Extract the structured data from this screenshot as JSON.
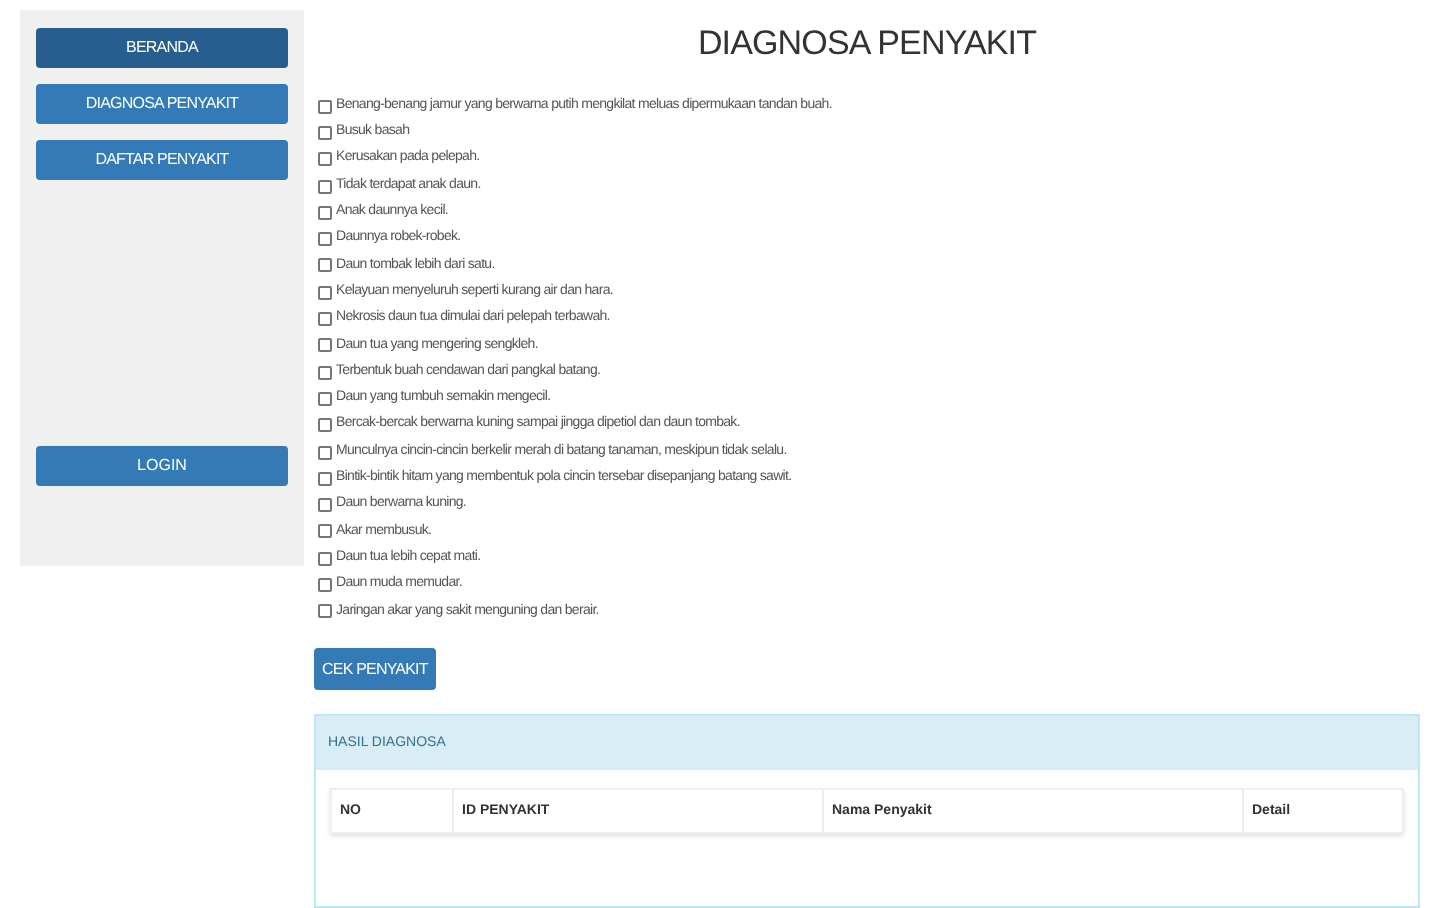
{
  "sidebar": {
    "items": [
      {
        "label": "BERANDA",
        "selected": true
      },
      {
        "label": "DIAGNOSA PENYAKIT",
        "selected": false
      },
      {
        "label": "DAFTAR PENYAKIT",
        "selected": false
      }
    ],
    "login": "LOGIN"
  },
  "title": "DIAGNOSA PENYAKIT",
  "symptoms": [
    {
      "label": "Benang-benang jamur yang berwarna putih mengkilat meluas dipermukaan tandan buah.",
      "checked": false
    },
    {
      "label": "Busuk basah",
      "checked": false
    },
    {
      "label": "Kerusakan pada pelepah.",
      "checked": false
    },
    {
      "label": "Tidak terdapat anak daun.",
      "checked": false
    },
    {
      "label": "Anak daunnya kecil.",
      "checked": false
    },
    {
      "label": "Daunnya robek-robek.",
      "checked": false
    },
    {
      "label": "Daun tombak lebih dari satu.",
      "checked": false
    },
    {
      "label": "Kelayuan menyeluruh seperti kurang air dan hara.",
      "checked": false
    },
    {
      "label": "Nekrosis daun tua dimulai dari pelepah terbawah.",
      "checked": false
    },
    {
      "label": "Daun tua yang mengering sengkleh.",
      "checked": false
    },
    {
      "label": "Terbentuk buah cendawan dari pangkal batang.",
      "checked": false
    },
    {
      "label": "Daun yang tumbuh semakin mengecil.",
      "checked": false
    },
    {
      "label": "Bercak-bercak berwarna kuning sampai jingga dipetiol dan daun tombak.",
      "checked": false
    },
    {
      "label": "Munculnya cincin-cincin berkelir merah di batang tanaman, meskipun tidak selalu.",
      "checked": false
    },
    {
      "label": "Bintik-bintik hitam yang membentuk pola cincin tersebar disepanjang batang sawit.",
      "checked": false
    },
    {
      "label": "Daun berwarna kuning.",
      "checked": false
    },
    {
      "label": "Akar membusuk.",
      "checked": false
    },
    {
      "label": "Daun tua lebih cepat mati.",
      "checked": false
    },
    {
      "label": "Daun muda memudar.",
      "checked": false
    },
    {
      "label": "Jaringan akar yang sakit menguning dan berair.",
      "checked": false
    }
  ],
  "check_button": "CEK PENYAKIT",
  "result": {
    "title": "HASIL DIAGNOSA",
    "columns": [
      "NO",
      "ID PENYAKIT",
      "Nama Penyakit",
      "Detail"
    ]
  }
}
